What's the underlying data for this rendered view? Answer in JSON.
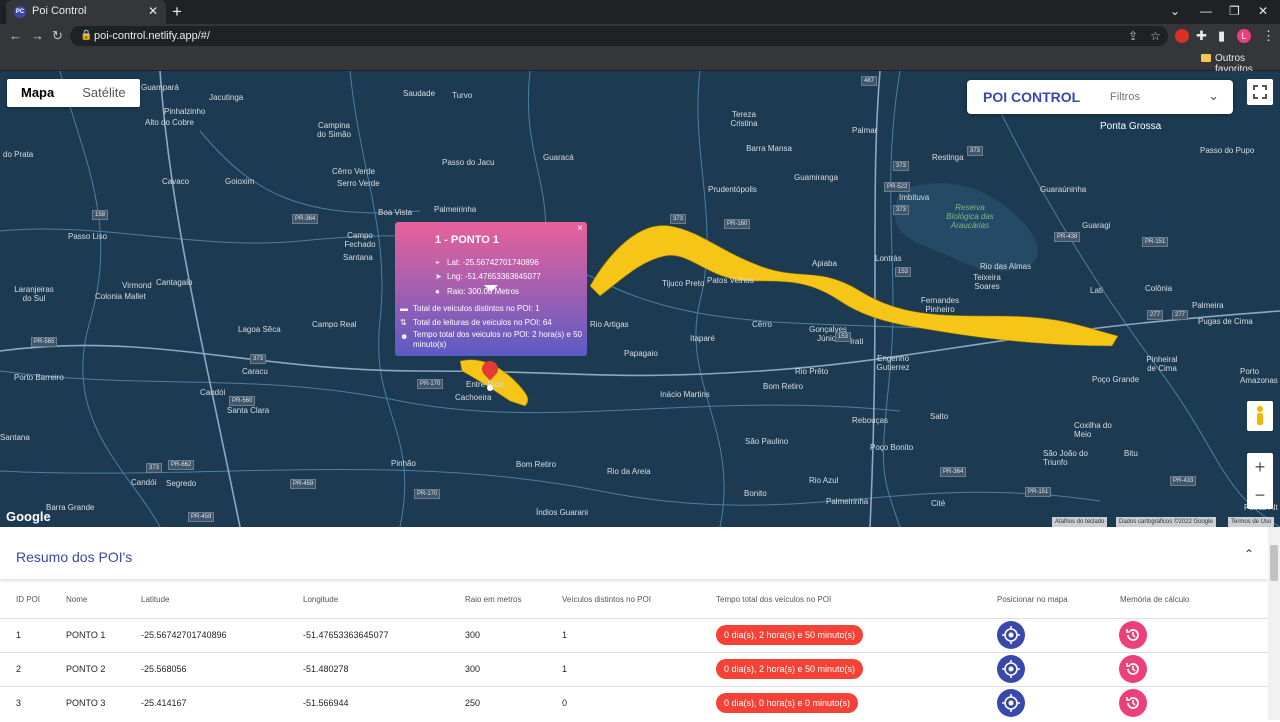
{
  "browser": {
    "tab_title": "Poi Control",
    "tab_favicon": "PC",
    "url": "poi-control.netlify.app/#/",
    "bookmark_folder": "Outros favoritos",
    "profile_initial": "L"
  },
  "map": {
    "map_label": "Mapa",
    "satellite_label": "Satélite",
    "google_logo": "Google",
    "attribution": {
      "shortcuts": "Atalhos do teclado",
      "data": "Dados cartográficos ©2022 Google",
      "terms": "Termos de Uso"
    },
    "places": [
      {
        "name": "Guampará"
      },
      {
        "name": "Jacutinga"
      },
      {
        "name": "Saudade"
      },
      {
        "name": "Turvo"
      },
      {
        "name": "Pinhalzinho"
      },
      {
        "name": "Alto do Cobre"
      },
      {
        "name": "Campina do Simão"
      },
      {
        "name": "Passo do Jacu"
      },
      {
        "name": "Guaracá"
      },
      {
        "name": "Tereza Cristina"
      },
      {
        "name": "Barra Mansa"
      },
      {
        "name": "Palmar"
      },
      {
        "name": "Ponta Grossa"
      },
      {
        "name": "do Prata"
      },
      {
        "name": "Cêrro Verde"
      },
      {
        "name": "Serro Verde"
      },
      {
        "name": "Restinga"
      },
      {
        "name": "Passo do Pupo"
      },
      {
        "name": "Cavaco"
      },
      {
        "name": "Goioxim"
      },
      {
        "name": "Prudentópolis"
      },
      {
        "name": "Guamiranga"
      },
      {
        "name": "Imbituva"
      },
      {
        "name": "Guaraúninha"
      },
      {
        "name": "Boa Vista"
      },
      {
        "name": "Palmeirinha"
      },
      {
        "name": "Reserva Biológica das Araucárias"
      },
      {
        "name": "Guaragi"
      },
      {
        "name": "Passo Liso"
      },
      {
        "name": "Campo Fechado"
      },
      {
        "name": "Santana"
      },
      {
        "name": "Irati"
      },
      {
        "name": "Lontrás"
      },
      {
        "name": "Rio das Almas"
      },
      {
        "name": "Teixeira Soares"
      },
      {
        "name": "Lati"
      },
      {
        "name": "Colônia"
      },
      {
        "name": "Palmeira"
      },
      {
        "name": "Pugas de Cima"
      },
      {
        "name": "Virmond"
      },
      {
        "name": "Cantagalo"
      },
      {
        "name": "Colonia Mallet"
      },
      {
        "name": "Laranjeiras do Sul"
      },
      {
        "name": "Tijuco Preto"
      },
      {
        "name": "Patos Velhos"
      },
      {
        "name": "Apiaba"
      },
      {
        "name": "Fernandes Pinheiro"
      },
      {
        "name": "Lagoa Sêca"
      },
      {
        "name": "Campo Real"
      },
      {
        "name": "Rio Artigas"
      },
      {
        "name": "Cêrro"
      },
      {
        "name": "Gonçalves Júnior"
      },
      {
        "name": "Papagaio"
      },
      {
        "name": "Itaparé"
      },
      {
        "name": "Engenho Gutierrez"
      },
      {
        "name": "Porto Barreiro"
      },
      {
        "name": "Caracu"
      },
      {
        "name": "Rio Prêto"
      },
      {
        "name": "Poço Grande"
      },
      {
        "name": "Pinheiral de Cima"
      },
      {
        "name": "Porto Amazonas"
      },
      {
        "name": "Candói"
      },
      {
        "name": "Santa Clara"
      },
      {
        "name": "Entre Rios"
      },
      {
        "name": "Cachoeira"
      },
      {
        "name": "Inácio Martins"
      },
      {
        "name": "Bom Retiro"
      },
      {
        "name": "Rebouças"
      },
      {
        "name": "Salto"
      },
      {
        "name": "Coxilha do Meio"
      },
      {
        "name": "Santana"
      },
      {
        "name": "São Paulino"
      },
      {
        "name": "Poço Bonito"
      },
      {
        "name": "São João do Triunfo"
      },
      {
        "name": "Bitu"
      },
      {
        "name": "Pinhão"
      },
      {
        "name": "Bom Retiro"
      },
      {
        "name": "Rio da Areia"
      },
      {
        "name": "Rio Azul"
      },
      {
        "name": "Candói"
      },
      {
        "name": "Segredo"
      },
      {
        "name": "Bonito"
      },
      {
        "name": "Barra Grande"
      },
      {
        "name": "Palmeirinha"
      },
      {
        "name": "Índios Guarani"
      },
      {
        "name": "Cité"
      },
      {
        "name": "Peiras Alt"
      }
    ],
    "shields": [
      "487",
      "373",
      "373",
      "373",
      "PR-522",
      "373",
      "PR-160",
      "PR-364",
      "158",
      "PR-438",
      "PR-151",
      "277",
      "PR-565",
      "373",
      "PR-170",
      "PR-560",
      "PR-662",
      "373",
      "PR-459",
      "PR-170",
      "PR-364",
      "PR-151",
      "PR-433",
      "PR-459",
      "153",
      "153",
      "277"
    ],
    "info_window": {
      "title": "1 - PONTO 1",
      "lat": "Lat: -25.56742701740896",
      "lng": "Lng: -51.47653363645077",
      "radius": "Raio: 300.00 Metros",
      "distinct_vehicles": "Total de veiculos distintos no POI: 1",
      "readings": "Total de leituras de veiculos no POI: 64",
      "total_time": "Tempo total dos veiculos no POI: 2 hora(s) e 50 minuto(s)",
      "close": "×"
    },
    "poi_panel": {
      "title": "POI CONTROL",
      "filter_placeholder": "Filtros"
    }
  },
  "summary": {
    "title": "Resumo dos POI's",
    "columns": [
      "ID POI",
      "Nome",
      "Latitude",
      "Longitude",
      "Raio em metros",
      "Veículos distintos no POI",
      "Tempo total dos veículos no POI",
      "Posicionar no mapa",
      "Memória de cálculo"
    ],
    "rows": [
      {
        "id": "1",
        "name": "PONTO 1",
        "lat": "-25.56742701740896",
        "lng": "-51.47653363645077",
        "radius": "300",
        "vehicles": "1",
        "time": "0 dia(s), 2 hora(s) e 50 minuto(s)"
      },
      {
        "id": "2",
        "name": "PONTO 2",
        "lat": "-25.568056",
        "lng": "-51.480278",
        "radius": "300",
        "vehicles": "1",
        "time": "0 dia(s), 2 hora(s) e 50 minuto(s)"
      },
      {
        "id": "3",
        "name": "PONTO 3",
        "lat": "-25.414167",
        "lng": "-51.566944",
        "radius": "250",
        "vehicles": "0",
        "time": "0 dia(s), 0 hora(s) e 0 minuto(s)"
      }
    ]
  },
  "colors": {
    "accent": "#3949ab",
    "pink": "#ec407a",
    "red": "#f44336",
    "map_bg": "#1c3b52"
  }
}
